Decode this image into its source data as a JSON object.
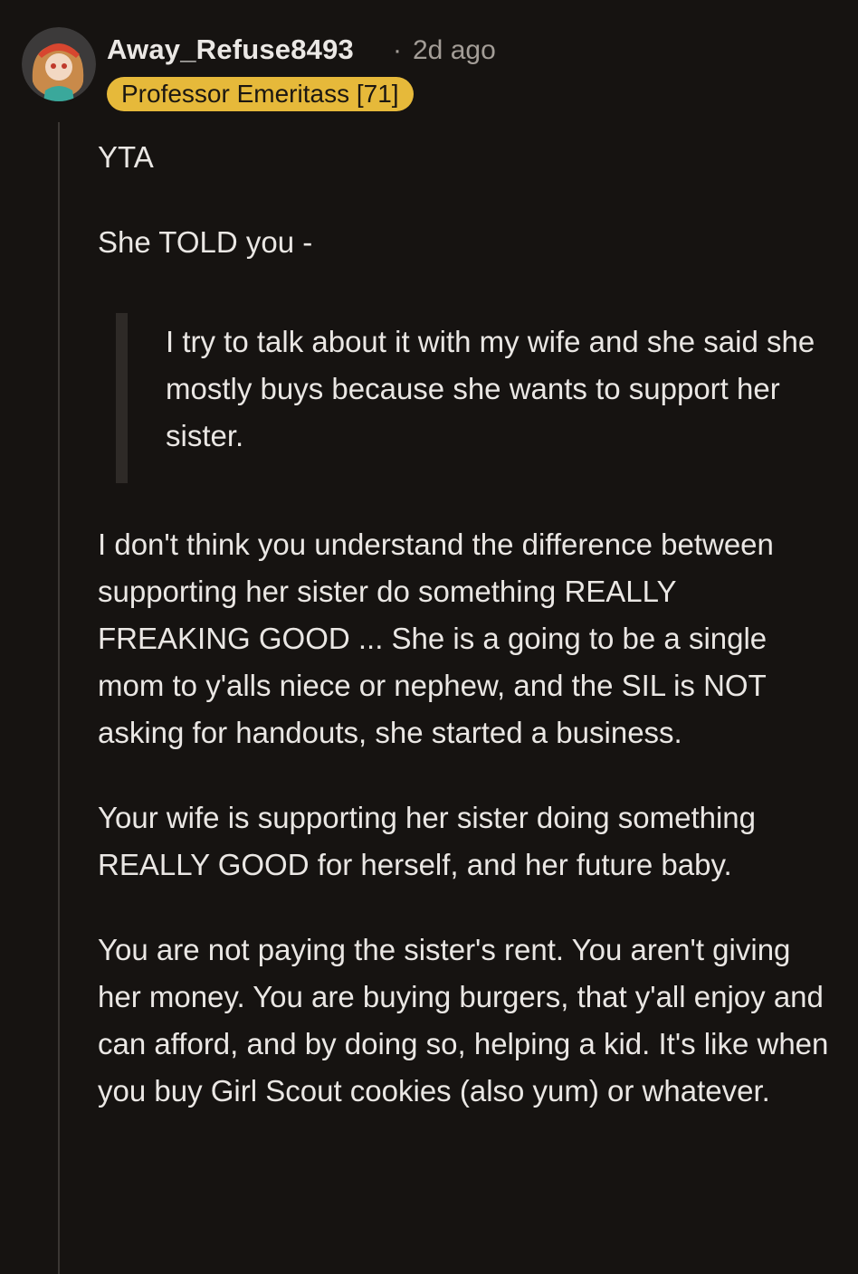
{
  "comment": {
    "author": "Away_Refuse8493",
    "separator": "·",
    "age": "2d ago",
    "flair": "Professor Emeritass [71]",
    "paragraphs": [
      "YTA",
      "She TOLD you -"
    ],
    "quote": "I try to talk about it with my wife and she said she mostly buys because she wants to support her sister.",
    "paragraphs_after_quote": [
      "I don't think you understand the difference between supporting her sister do something REALLY FREAKING GOOD ... She is a going to be a single mom to y'alls niece or nephew, and the SIL is NOT asking for handouts, she started a business.",
      "Your wife is supporting her sister doing something REALLY GOOD for herself, and her future baby.",
      "You are not paying the sister's rent. You aren't giving her money. You are buying burgers, that y'all enjoy and can afford, and by doing so, helping a kid. It's like when you buy Girl Scout cookies (also yum) or whatever."
    ]
  },
  "colors": {
    "background": "#161311",
    "flair_bg": "#e6b93a",
    "meta_text": "#a39d97",
    "thread_line": "#3a3633"
  },
  "icons": {
    "avatar": "user-avatar-icon"
  }
}
